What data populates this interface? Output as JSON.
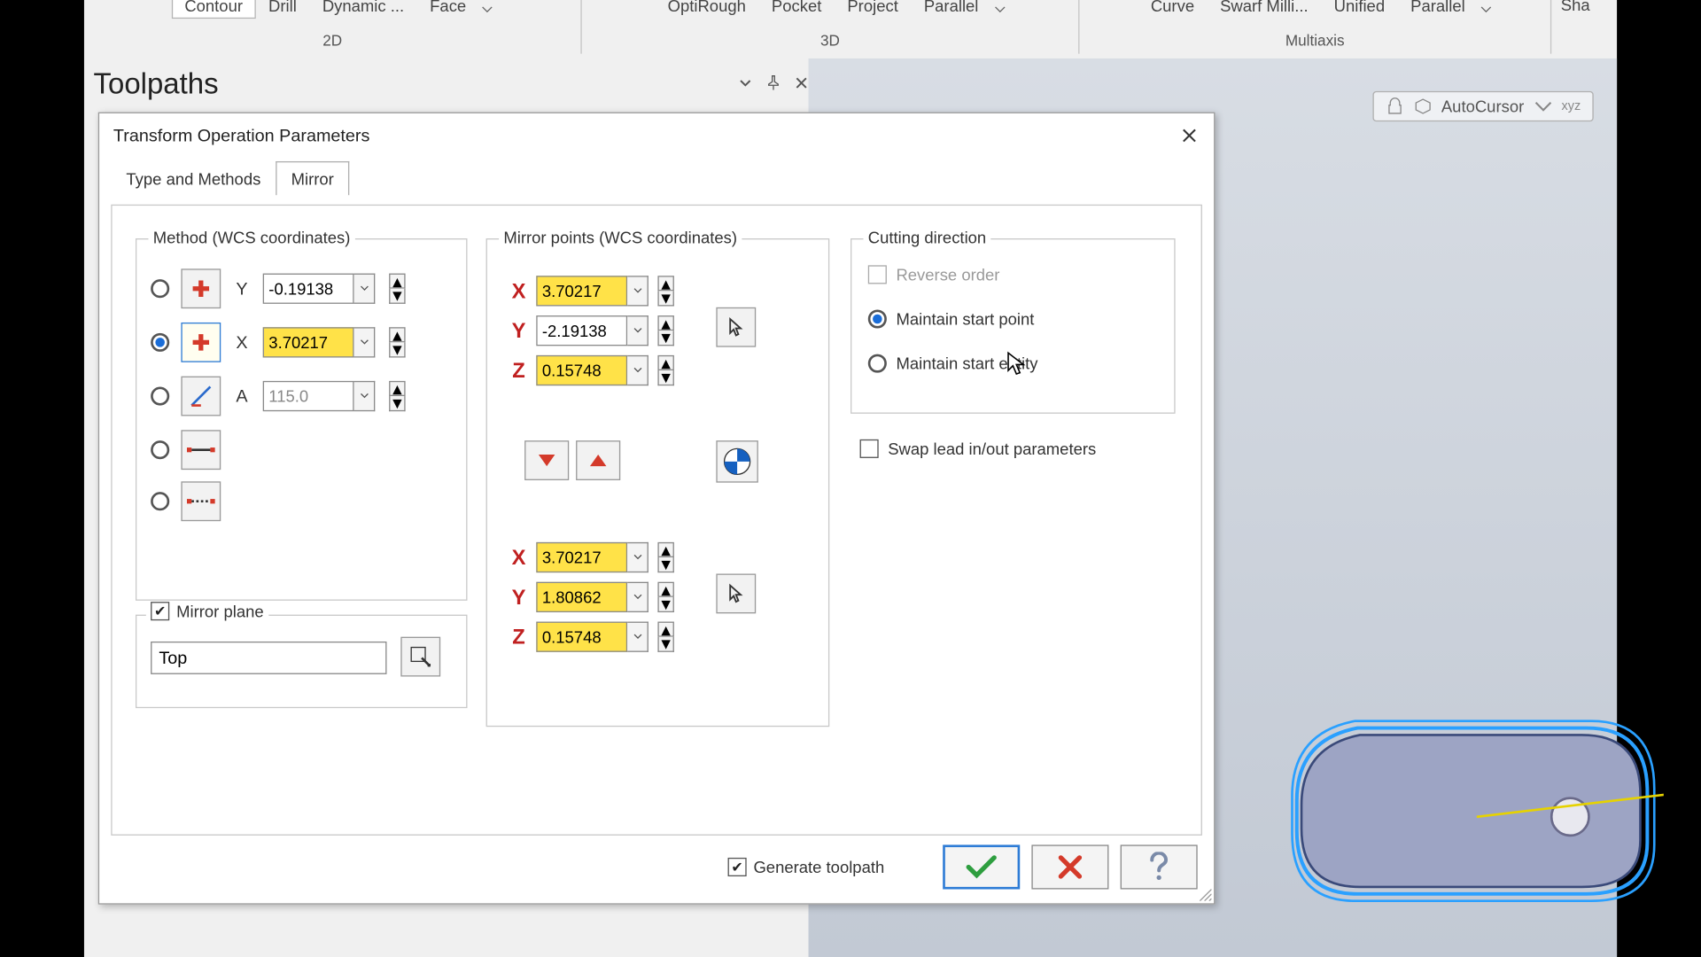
{
  "ribbon": {
    "g2d": [
      "Contour",
      "Drill",
      "Dynamic ...",
      "Face"
    ],
    "g3d": [
      "OptiRough",
      "Pocket",
      "Project",
      "Parallel"
    ],
    "gmx": [
      "Curve",
      "Swarf Milli...",
      "Unified",
      "Parallel"
    ],
    "labels": [
      "2D",
      "3D",
      "Multiaxis"
    ],
    "extra": "Sha"
  },
  "panel": {
    "title": "Toolpaths"
  },
  "viewport": {
    "autocursor": "AutoCursor"
  },
  "dialog": {
    "title": "Transform Operation Parameters",
    "tabs": [
      "Type and Methods",
      "Mirror"
    ],
    "method": {
      "legend": "Method (WCS coordinates)",
      "rows": [
        {
          "axis": "Y",
          "value": "-0.19138",
          "selected": false
        },
        {
          "axis": "X",
          "value": "3.70217",
          "selected": true,
          "highlight": true
        },
        {
          "axis": "A",
          "value": "115.0",
          "selected": false
        }
      ]
    },
    "mirror_plane": {
      "label": "Mirror plane",
      "checked": true,
      "value": "Top"
    },
    "points": {
      "legend": "Mirror points (WCS coordinates)",
      "pt1": {
        "x": "3.70217",
        "y": "-2.19138",
        "z": "0.15748"
      },
      "pt2": {
        "x": "3.70217",
        "y": "1.80862",
        "z": "0.15748"
      }
    },
    "cutting": {
      "legend": "Cutting direction",
      "reverse": "Reverse order",
      "opt1": "Maintain start point",
      "opt2": "Maintain start entity",
      "selected": "opt1"
    },
    "swap_lead": "Swap lead in/out parameters",
    "footer": {
      "generate": "Generate toolpath"
    }
  }
}
